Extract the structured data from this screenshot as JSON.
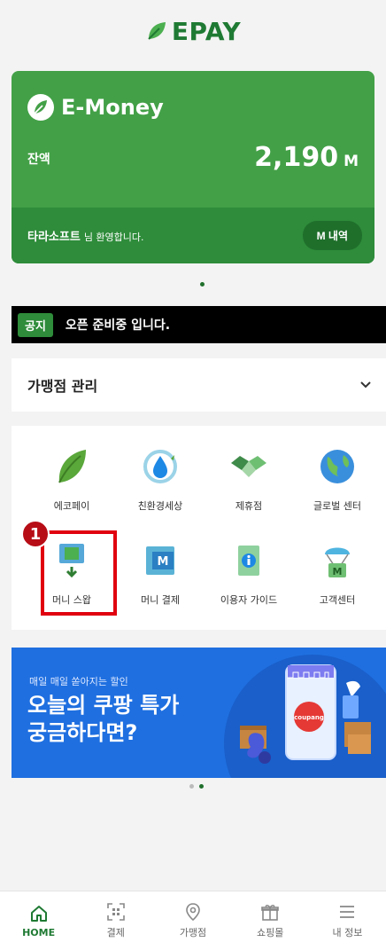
{
  "app": {
    "logo_text": "EPAY"
  },
  "emoney": {
    "title": "E-Money",
    "balance_label": "잔액",
    "balance_value": "2,190",
    "balance_unit": "M",
    "user_name": "타라소프트",
    "welcome_suffix": "님 환영합니다.",
    "history_button": "M 내역"
  },
  "notice": {
    "badge": "공지",
    "text": "오픈 준비중 입니다."
  },
  "merchant": {
    "title": "가맹점 관리",
    "chevron": "⌄"
  },
  "menu": {
    "items": [
      {
        "label": "에코페이",
        "icon": "leaf-icon"
      },
      {
        "label": "친환경세상",
        "icon": "water-drop-icon"
      },
      {
        "label": "제휴점",
        "icon": "handshake-icon"
      },
      {
        "label": "글로벌 센터",
        "icon": "globe-icon"
      },
      {
        "label": "머니 스왑",
        "icon": "money-swap-icon"
      },
      {
        "label": "머니 결제",
        "icon": "money-payment-icon"
      },
      {
        "label": "이용자 가이드",
        "icon": "user-guide-icon"
      },
      {
        "label": "고객센터",
        "icon": "customer-center-icon"
      }
    ]
  },
  "annotation": {
    "step_number": "1"
  },
  "banner": {
    "small_text": "매일 매일 쏟아지는 할인",
    "title_line1": "오늘의 쿠팡 특가",
    "title_line2": "궁금하다면?",
    "coupang_label": "coupang"
  },
  "carousel": {
    "count": 2,
    "active_index": 1
  },
  "bottom_nav": {
    "items": [
      {
        "label": "HOME",
        "icon": "home-icon"
      },
      {
        "label": "결제",
        "icon": "qr-scan-icon"
      },
      {
        "label": "가맹점",
        "icon": "location-pin-icon"
      },
      {
        "label": "쇼핑몰",
        "icon": "gift-icon"
      },
      {
        "label": "내 정보",
        "icon": "hamburger-menu-icon"
      }
    ]
  },
  "colors": {
    "brand_green": "#43a047",
    "dark_green": "#1f7a33",
    "highlight_red": "#e0000f",
    "banner_blue": "#1f6fe0"
  }
}
